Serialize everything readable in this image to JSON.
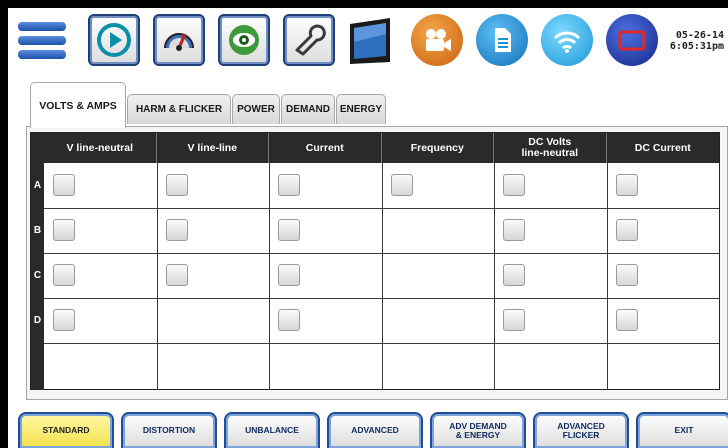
{
  "toolbar": {
    "icons": [
      "menu-icon",
      "play-icon",
      "gauge-icon",
      "eye-icon",
      "wrench-icon",
      "monitor-icon",
      "camera-icon",
      "document-icon",
      "wireless-icon",
      "screen-icon"
    ],
    "date": "05-26-14",
    "time": "6:05:31pm"
  },
  "tabs": [
    {
      "label": "VOLTS & AMPS",
      "active": true
    },
    {
      "label": "HARM & FLICKER",
      "active": false
    },
    {
      "label": "POWER",
      "active": false
    },
    {
      "label": "DEMAND",
      "active": false
    },
    {
      "label": "ENERGY",
      "active": false
    }
  ],
  "table": {
    "columns": [
      "V line-neutral",
      "V line-line",
      "Current",
      "Frequency",
      "DC Volts line-neutral",
      "DC Current"
    ],
    "column_lines": [
      [
        "V line-neutral"
      ],
      [
        "V line-line"
      ],
      [
        "Current"
      ],
      [
        "Frequency"
      ],
      [
        "DC Volts",
        "line-neutral"
      ],
      [
        "DC Current"
      ]
    ],
    "rows": [
      "A",
      "B",
      "C",
      "D"
    ],
    "checkboxes": {
      "A": [
        false,
        false,
        false,
        false,
        false,
        false
      ],
      "B": [
        false,
        false,
        false,
        null,
        false,
        false
      ],
      "C": [
        false,
        false,
        false,
        null,
        false,
        false
      ],
      "D": [
        false,
        null,
        false,
        null,
        false,
        false
      ]
    }
  },
  "buttons": [
    {
      "label": "STANDARD",
      "selected": true
    },
    {
      "label": "DISTORTION",
      "selected": false
    },
    {
      "label": "UNBALANCE",
      "selected": false
    },
    {
      "label": "ADVANCED",
      "selected": false
    },
    {
      "label": "ADV DEMAND & ENERGY",
      "selected": false
    },
    {
      "label": "ADVANCED FLICKER",
      "selected": false
    },
    {
      "label": "EXIT",
      "selected": false
    }
  ],
  "colors": {
    "selected_button": "#f3e04a",
    "button_border": "#1f4e96",
    "header_bg": "#2a2a2a",
    "camera_icon": "#e07a1f",
    "document_icon": "#1e8fd6",
    "wireless_icon": "#29a9e6",
    "screen_icon": "#1e3a9e"
  }
}
